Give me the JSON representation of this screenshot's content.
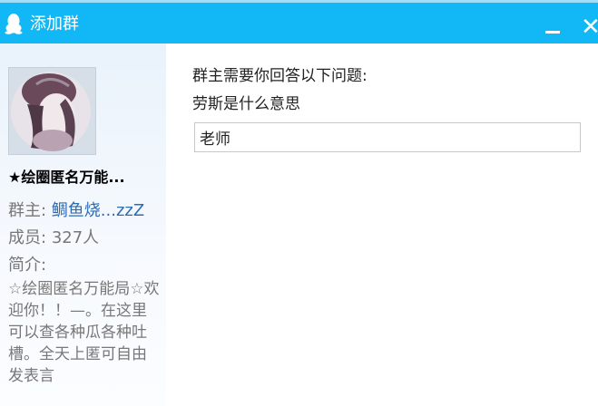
{
  "window": {
    "title": "添加群",
    "minimize_symbol": "—",
    "close_symbol": "✕"
  },
  "group": {
    "name": "★绘圈匿名万能...",
    "owner_label": "群主:",
    "owner_name": "鲷鱼烧...zzZ",
    "members_label": "成员:",
    "members_value": "327人",
    "intro_label": "简介:",
    "intro_text": "☆绘圈匿名万能局☆欢迎你！！—。在这里可以查各种瓜各种吐槽。全天上匿可自由发表言"
  },
  "question": {
    "header": "群主需要你回答以下问题:",
    "text": "劳斯是什么意思"
  },
  "answer": {
    "value": "老师"
  },
  "colors": {
    "titlebar": "#12b7f5",
    "link": "#2d6bb3"
  }
}
